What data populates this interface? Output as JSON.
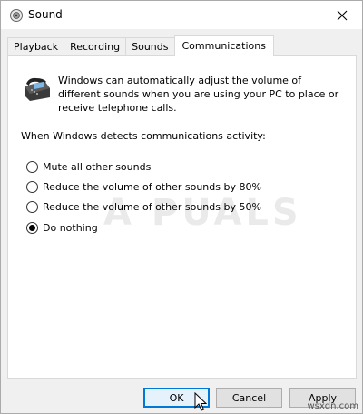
{
  "window": {
    "title": "Sound",
    "close_icon": "close-icon"
  },
  "tabs": [
    {
      "label": "Playback",
      "active": false
    },
    {
      "label": "Recording",
      "active": false
    },
    {
      "label": "Sounds",
      "active": false
    },
    {
      "label": "Communications",
      "active": true
    }
  ],
  "panel": {
    "description": "Windows can automatically adjust the volume of different sounds when you are using your PC to place or receive telephone calls.",
    "prompt": "When Windows detects communications activity:",
    "options": [
      {
        "label": "Mute all other sounds",
        "checked": false
      },
      {
        "label": "Reduce the volume of other sounds by 80%",
        "checked": false
      },
      {
        "label": "Reduce the volume of other sounds by 50%",
        "checked": false
      },
      {
        "label": "Do nothing",
        "checked": true
      }
    ],
    "watermark": "APPUALS"
  },
  "buttons": {
    "ok": "OK",
    "cancel": "Cancel",
    "apply": "Apply"
  },
  "footer_watermark": "wsxdn.com",
  "colors": {
    "accent": "#0078d7",
    "panel_bg": "#ffffff",
    "window_bg": "#f0f0f0"
  }
}
